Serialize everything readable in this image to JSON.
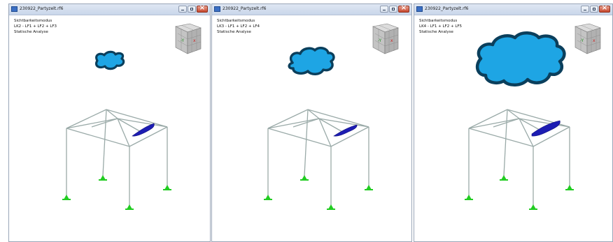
{
  "windows": [
    {
      "title": "230922_Partyzelt.rf6",
      "info": [
        "Sichtbarkeitsmodus",
        "LK2 - LF1 + LF2 + LF3",
        "Statische Analyse"
      ],
      "cube_label": "-Y"
    },
    {
      "title": "230922_Partyzelt.rf6",
      "info": [
        "Sichtbarkeitsmodus",
        "LK3 - LF1 + LF2 + LF4",
        "Statische Analyse"
      ],
      "cube_label": "-Y"
    },
    {
      "title": "230922_Partyzelt.rf6",
      "info": [
        "Sichtbarkeitsmodus",
        "LK4 - LF1 + LF2 + LF5",
        "Statische Analyse"
      ],
      "cube_label": "-Y"
    }
  ],
  "colors": {
    "cloud_fill": "#1ea5e4",
    "cloud_stroke": "#0b3f5c",
    "frame": "#9aaaa8",
    "support": "#22cc22",
    "deformation": "#1d1db3",
    "cube": "#c9c9c9"
  }
}
